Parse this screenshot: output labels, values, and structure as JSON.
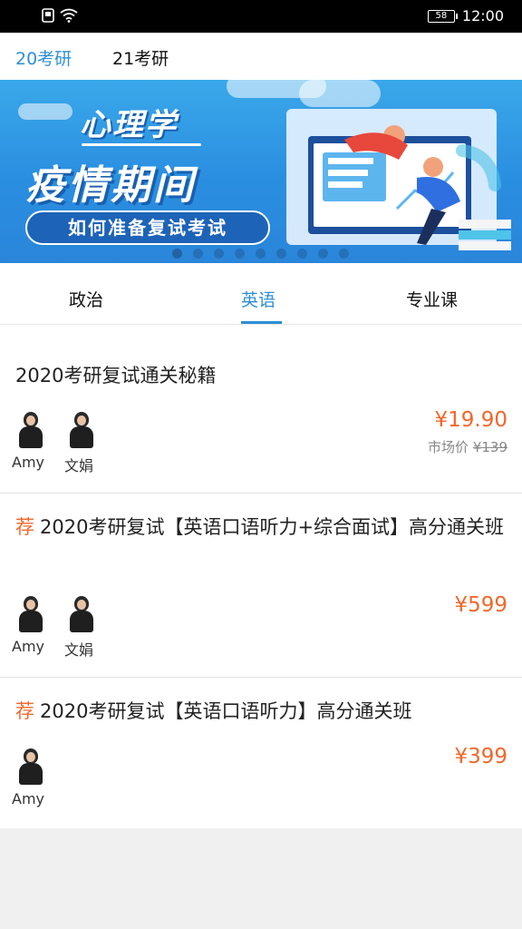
{
  "status_bar": {
    "battery": "58",
    "time": "12:00"
  },
  "top_tabs": [
    {
      "label": "20考研",
      "active": true
    },
    {
      "label": "21考研",
      "active": false
    }
  ],
  "banner": {
    "title_small": "心理学",
    "title_large": "疫情期间",
    "pill_text": "如何准备复试考试",
    "dot_count": 9,
    "active_dot": 0
  },
  "subject_tabs": [
    {
      "label": "政治",
      "active": false
    },
    {
      "label": "英语",
      "active": true
    },
    {
      "label": "专业课",
      "active": false
    }
  ],
  "courses": [
    {
      "recommended": false,
      "title": "2020考研复试通关秘籍",
      "teachers": [
        "Amy",
        "文娟"
      ],
      "price": "¥19.90",
      "market_label": "市场价",
      "market_price": "¥139"
    },
    {
      "recommended": true,
      "rec_label": "荐",
      "title": "2020考研复试【英语口语听力+综合面试】高分通关班",
      "teachers": [
        "Amy",
        "文娟"
      ],
      "price": "¥599"
    },
    {
      "recommended": true,
      "rec_label": "荐",
      "title": "2020考研复试【英语口语听力】高分通关班",
      "teachers": [
        "Amy"
      ],
      "price": "¥399"
    }
  ],
  "colors": {
    "accent_blue": "#2d8fd6",
    "price_orange": "#f2672a",
    "banner_blue": "#2a8ee0"
  }
}
